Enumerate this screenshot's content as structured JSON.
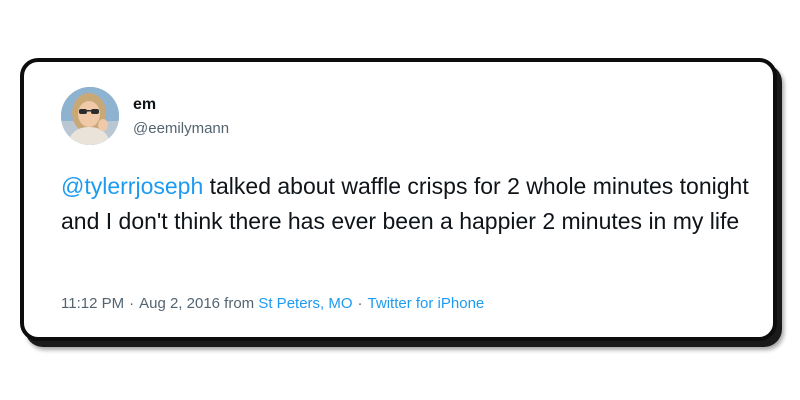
{
  "tweet": {
    "author_name": "em",
    "author_handle": "@eemilymann",
    "mention": "@tylerrjoseph",
    "text": " talked about waffle crisps for 2 whole minutes tonight and I don't think there has ever been a happier 2 minutes in my life",
    "time": "11:12 PM",
    "date": "Aug 2, 2016",
    "from_label": "from",
    "location": "St Peters, MO",
    "client": "Twitter for iPhone",
    "separator": "·"
  },
  "colors": {
    "link": "#1d9bf0",
    "text": "#0f1419",
    "secondary": "#536471",
    "card_border": "#0d0d0d"
  },
  "icons": {
    "avatar": "avatar-photo"
  }
}
